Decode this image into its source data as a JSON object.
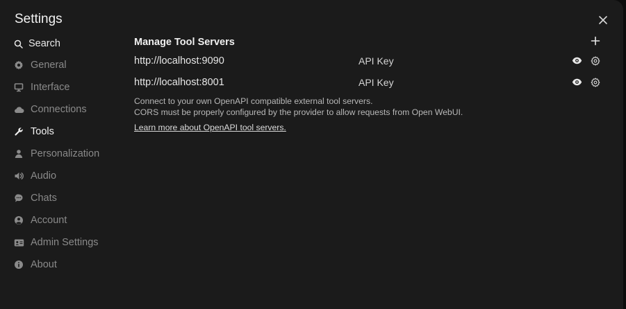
{
  "window": {
    "title": "Settings"
  },
  "sidebar": {
    "search_label": "Search",
    "items": [
      {
        "label": "General",
        "icon": "gear-icon"
      },
      {
        "label": "Interface",
        "icon": "monitor-icon"
      },
      {
        "label": "Connections",
        "icon": "cloud-icon"
      },
      {
        "label": "Tools",
        "icon": "wrench-icon",
        "active": true
      },
      {
        "label": "Personalization",
        "icon": "user-icon"
      },
      {
        "label": "Audio",
        "icon": "speaker-icon"
      },
      {
        "label": "Chats",
        "icon": "chat-bubble-icon"
      },
      {
        "label": "Account",
        "icon": "account-circle-icon"
      },
      {
        "label": "Admin Settings",
        "icon": "id-card-icon"
      },
      {
        "label": "About",
        "icon": "info-icon"
      }
    ]
  },
  "main": {
    "section_title": "Manage Tool Servers",
    "servers": [
      {
        "url": "http://localhost:9090",
        "key_label": "API Key"
      },
      {
        "url": "http://localhost:8001",
        "key_label": "API Key"
      }
    ],
    "description_line1": "Connect to your own OpenAPI compatible external tool servers.",
    "description_line2": "CORS must be properly configured by the provider to allow requests from Open WebUI.",
    "learn_more": "Learn more about OpenAPI tool servers."
  },
  "colors": {
    "background": "#1b1b1b",
    "backdrop": "#0c0c0c",
    "text_primary": "#f2f2f2",
    "text_muted": "#8a8a8a"
  }
}
